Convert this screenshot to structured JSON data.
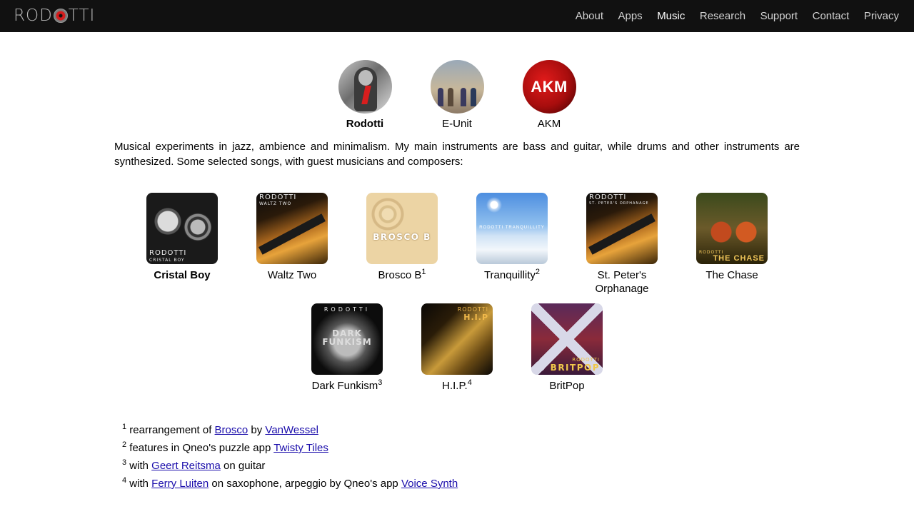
{
  "header": {
    "logo": {
      "left": "ROD",
      "right": "TTI"
    },
    "nav": [
      {
        "label": "About",
        "active": false
      },
      {
        "label": "Apps",
        "active": false
      },
      {
        "label": "Music",
        "active": true
      },
      {
        "label": "Research",
        "active": false
      },
      {
        "label": "Support",
        "active": false
      },
      {
        "label": "Contact",
        "active": false
      },
      {
        "label": "Privacy",
        "active": false
      }
    ]
  },
  "artists": [
    {
      "name": "Rodotti",
      "selected": true
    },
    {
      "name": "E-Unit",
      "selected": false
    },
    {
      "name": "AKM",
      "selected": false,
      "badge": "AKM"
    }
  ],
  "intro": "Musical experiments in jazz, ambience and minimalism. My main instruments are bass and guitar, while drums and other instruments are synthesized. Some selected songs, with guest musicians and composers:",
  "albums": [
    {
      "title": "Cristal Boy",
      "note": "",
      "cover_text": "RODOTTI",
      "cover_sub": "CRISTAL BOY"
    },
    {
      "title": "Waltz Two",
      "note": "",
      "cover_text": "RODOTTI",
      "cover_sub": "WALTZ TWO"
    },
    {
      "title": "Brosco B",
      "note": "1",
      "cover_text": "BROSCO B"
    },
    {
      "title": "Tranquillity",
      "note": "2",
      "cover_text": "RODOTTI TRANQUILLITY"
    },
    {
      "title_line1": "St. Peter's",
      "title_line2": "Orphanage",
      "note": "",
      "cover_text": "RODOTTI",
      "cover_sub": "ST. PETER'S ORPHANAGE"
    },
    {
      "title": "The Chase",
      "note": "",
      "cover_text": "RODOTTI",
      "cover_sub": "THE CHASE"
    },
    {
      "title": "Dark Funkism",
      "note": "3",
      "cover_text": "RODOTTI",
      "cover_line1": "DARK",
      "cover_line2": "FUNKISM"
    },
    {
      "title": "H.I.P.",
      "note": "4",
      "cover_text": "RODOTTI",
      "cover_sub": "H.I.P"
    },
    {
      "title": "BritPop",
      "note": "",
      "cover_text": "RODOTTI",
      "cover_sub": "BRITPOP"
    }
  ],
  "footnotes": [
    {
      "num": "1",
      "t1": "rearrangement of",
      "link1": "Brosco",
      "t2": "by",
      "link2": "VanWessel"
    },
    {
      "num": "2",
      "t1": "features in Qneo's puzzle app",
      "link1": "Twisty Tiles"
    },
    {
      "num": "3",
      "t1": "with",
      "link1": "Geert Reitsma",
      "t2": "on guitar"
    },
    {
      "num": "4",
      "t1": "with",
      "link1": "Ferry Luiten",
      "t2": "on saxophone, arpeggio by Qneo's app",
      "link2": "Voice Synth"
    }
  ],
  "colors": {
    "nav_bg": "#111111",
    "accent": "#d51c1c",
    "link": "#1a0dab"
  }
}
